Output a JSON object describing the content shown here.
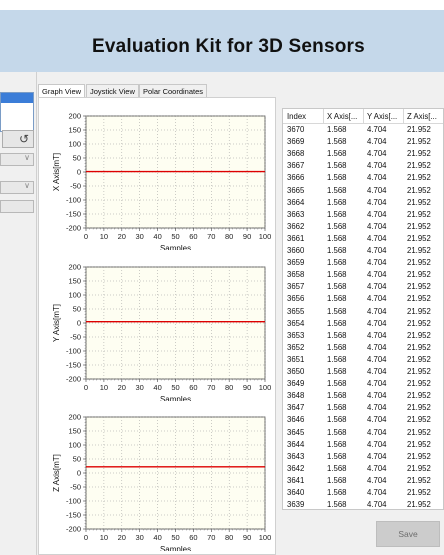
{
  "header": {
    "title": "Evaluation Kit for 3D Sensors"
  },
  "tabs": [
    "Graph View",
    "Joystick View",
    "Polar Coordinates"
  ],
  "left_panel": {
    "refresh_icon": "refresh-icon"
  },
  "table": {
    "columns": [
      "Index",
      "X Axis[...",
      "Y Axis[...",
      "Z Axis[..."
    ],
    "rows": [
      [
        "3670",
        "1.568",
        "4.704",
        "21.952"
      ],
      [
        "3669",
        "1.568",
        "4.704",
        "21.952"
      ],
      [
        "3668",
        "1.568",
        "4.704",
        "21.952"
      ],
      [
        "3667",
        "1.568",
        "4.704",
        "21.952"
      ],
      [
        "3666",
        "1.568",
        "4.704",
        "21.952"
      ],
      [
        "3665",
        "1.568",
        "4.704",
        "21.952"
      ],
      [
        "3664",
        "1.568",
        "4.704",
        "21.952"
      ],
      [
        "3663",
        "1.568",
        "4.704",
        "21.952"
      ],
      [
        "3662",
        "1.568",
        "4.704",
        "21.952"
      ],
      [
        "3661",
        "1.568",
        "4.704",
        "21.952"
      ],
      [
        "3660",
        "1.568",
        "4.704",
        "21.952"
      ],
      [
        "3659",
        "1.568",
        "4.704",
        "21.952"
      ],
      [
        "3658",
        "1.568",
        "4.704",
        "21.952"
      ],
      [
        "3657",
        "1.568",
        "4.704",
        "21.952"
      ],
      [
        "3656",
        "1.568",
        "4.704",
        "21.952"
      ],
      [
        "3655",
        "1.568",
        "4.704",
        "21.952"
      ],
      [
        "3654",
        "1.568",
        "4.704",
        "21.952"
      ],
      [
        "3653",
        "1.568",
        "4.704",
        "21.952"
      ],
      [
        "3652",
        "1.568",
        "4.704",
        "21.952"
      ],
      [
        "3651",
        "1.568",
        "4.704",
        "21.952"
      ],
      [
        "3650",
        "1.568",
        "4.704",
        "21.952"
      ],
      [
        "3649",
        "1.568",
        "4.704",
        "21.952"
      ],
      [
        "3648",
        "1.568",
        "4.704",
        "21.952"
      ],
      [
        "3647",
        "1.568",
        "4.704",
        "21.952"
      ],
      [
        "3646",
        "1.568",
        "4.704",
        "21.952"
      ],
      [
        "3645",
        "1.568",
        "4.704",
        "21.952"
      ],
      [
        "3644",
        "1.568",
        "4.704",
        "21.952"
      ],
      [
        "3643",
        "1.568",
        "4.704",
        "21.952"
      ],
      [
        "3642",
        "1.568",
        "4.704",
        "21.952"
      ],
      [
        "3641",
        "1.568",
        "4.704",
        "21.952"
      ],
      [
        "3640",
        "1.568",
        "4.704",
        "21.952"
      ],
      [
        "3639",
        "1.568",
        "4.704",
        "21.952"
      ]
    ]
  },
  "save_label": "Save",
  "colors": {
    "plot_bg": "#fefef2",
    "series": "#dd0000",
    "header_bg": "#c5d8ea"
  },
  "chart_data": [
    {
      "type": "line",
      "xlabel": "Samples",
      "ylabel": "X Axis[mT]",
      "xlim": [
        0,
        100
      ],
      "ylim": [
        -200,
        200
      ],
      "xticks": [
        0,
        10,
        20,
        30,
        40,
        50,
        60,
        70,
        80,
        90,
        100
      ],
      "yticks": [
        200,
        150,
        100,
        50,
        0,
        -50,
        -100,
        -150,
        -200
      ],
      "x": [
        0,
        100
      ],
      "values": [
        1.568,
        1.568
      ]
    },
    {
      "type": "line",
      "xlabel": "Samples",
      "ylabel": "Y Axis[mT]",
      "xlim": [
        0,
        100
      ],
      "ylim": [
        -200,
        200
      ],
      "xticks": [
        0,
        10,
        20,
        30,
        40,
        50,
        60,
        70,
        80,
        90,
        100
      ],
      "yticks": [
        200,
        150,
        100,
        50,
        0,
        -50,
        -100,
        -150,
        -200
      ],
      "x": [
        0,
        100
      ],
      "values": [
        4.704,
        4.704
      ]
    },
    {
      "type": "line",
      "xlabel": "Samples",
      "ylabel": "Z Axis[mT]",
      "xlim": [
        0,
        100
      ],
      "ylim": [
        -200,
        200
      ],
      "xticks": [
        0,
        10,
        20,
        30,
        40,
        50,
        60,
        70,
        80,
        90,
        100
      ],
      "yticks": [
        200,
        150,
        100,
        50,
        0,
        -50,
        -100,
        -150,
        -200
      ],
      "x": [
        0,
        100
      ],
      "values": [
        21.952,
        21.952
      ]
    }
  ]
}
